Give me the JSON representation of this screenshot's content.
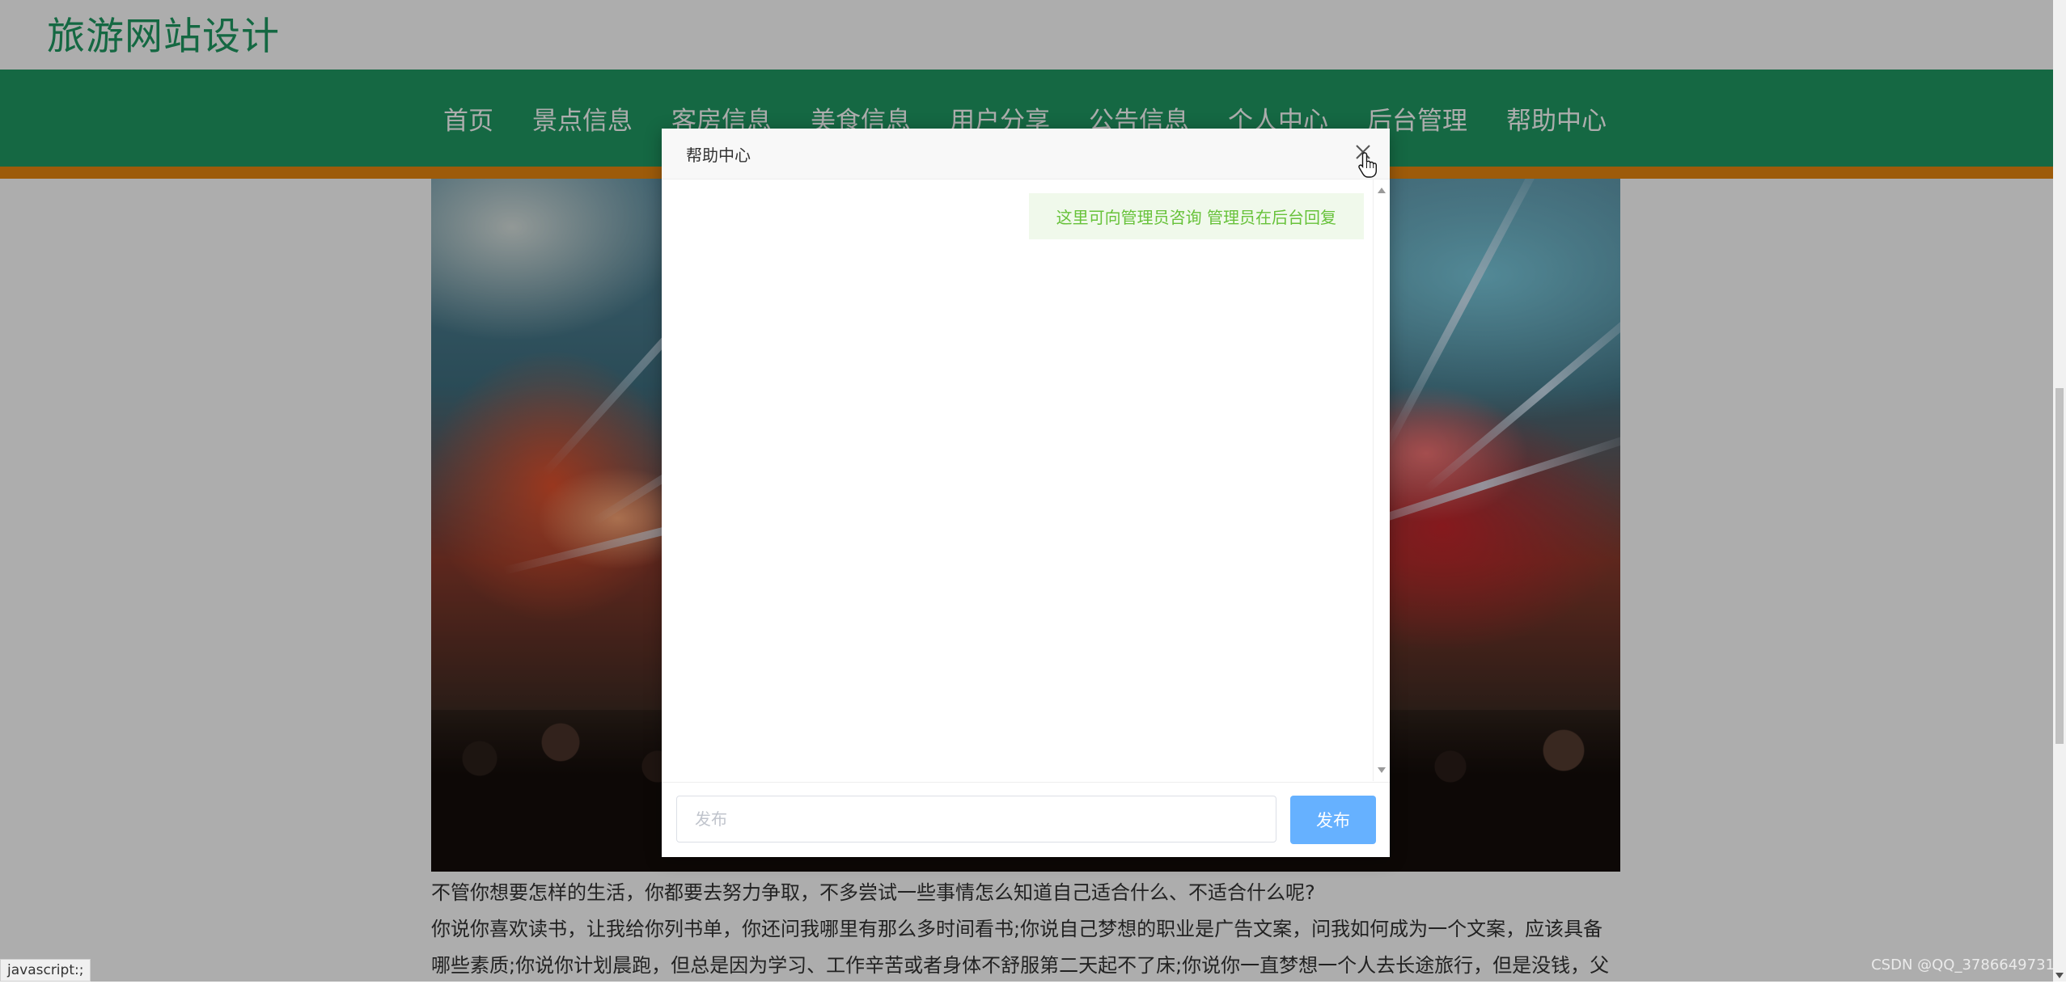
{
  "site": {
    "title": "旅游网站设计"
  },
  "nav": {
    "items": [
      {
        "label": "首页"
      },
      {
        "label": "景点信息"
      },
      {
        "label": "客房信息"
      },
      {
        "label": "美食信息"
      },
      {
        "label": "用户分享"
      },
      {
        "label": "公告信息"
      },
      {
        "label": "个人中心"
      },
      {
        "label": "后台管理"
      },
      {
        "label": "帮助中心"
      }
    ]
  },
  "article": {
    "line1": "不管你想要怎样的生活，你都要去努力争取，不多尝试一些事情怎么知道自己适合什么、不适合什么呢?",
    "line2": "你说你喜欢读书，让我给你列书单，你还问我哪里有那么多时间看书;你说自己梦想的职业是广告文案，问我如何成为一个文案，应该具备",
    "line3": "哪些素质;你说你计划晨跑，但总是因为学习、工作辛苦或者身体不舒服第二天起不了床;你说你一直梦想一个人去长途旅行，但是没钱，父"
  },
  "modal": {
    "title": "帮助中心",
    "close_icon": "close-icon",
    "messages": [
      {
        "text": "这里可向管理员咨询 管理员在后台回复"
      }
    ],
    "input_placeholder": "发布",
    "input_value": "",
    "submit_label": "发布"
  },
  "status_bar": {
    "url": "javascript:;"
  },
  "watermark": "CSDN @QQ_3786649731",
  "colors": {
    "brand_green": "#1f9a63",
    "accent_orange": "#e8870f",
    "button_blue": "#66b1ff",
    "message_bg": "#f0f9eb",
    "message_text": "#67c23a"
  }
}
